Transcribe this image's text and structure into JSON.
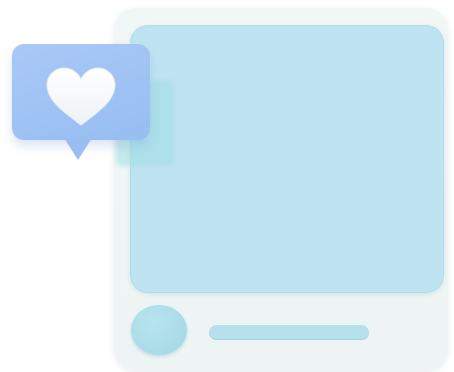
{
  "illustration": {
    "subject": "social-post-like",
    "icons": {
      "bubble": "speech-bubble-icon",
      "heart": "heart-icon"
    },
    "colors": {
      "card": "#eef4f4",
      "media": "#bfe4f1",
      "avatar": "#a9dbe7",
      "caption": "#b6e1ec",
      "bubble": "#9fc3f4",
      "heart": "#f7f9fb"
    }
  }
}
